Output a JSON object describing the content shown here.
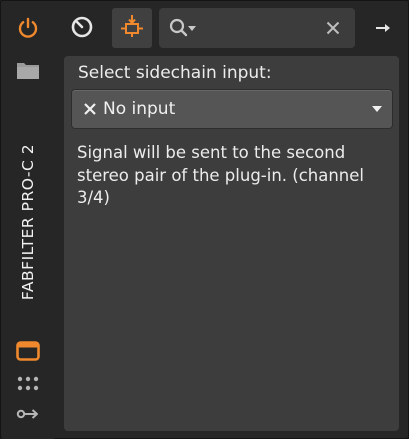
{
  "app": {
    "plugin_title": "FABFILTER PRO-C 2"
  },
  "icons": {
    "power": "power-icon",
    "preset_folder": "folder-icon",
    "window": "window-icon",
    "more": "grid-dots-icon",
    "routing": "routing-icon",
    "knob": "knob-icon",
    "sidechain": "sidechain-icon",
    "search": "search-icon",
    "clear": "close-icon",
    "expand": "arrow-right-icon",
    "dropdown_clear": "x-icon",
    "dropdown_caret": "caret-down-icon"
  },
  "colors": {
    "accent": "#f0892d",
    "panel_bg": "#3d3d3d",
    "rail_bg": "#262626",
    "text": "#ececec"
  },
  "toolbar": {
    "search_value": "",
    "search_placeholder": ""
  },
  "sidechain": {
    "heading": "Select sidechain input:",
    "selected": "No input",
    "description": "Signal will be sent to the second stereo pair of the plug-in. (channel 3/4)"
  }
}
